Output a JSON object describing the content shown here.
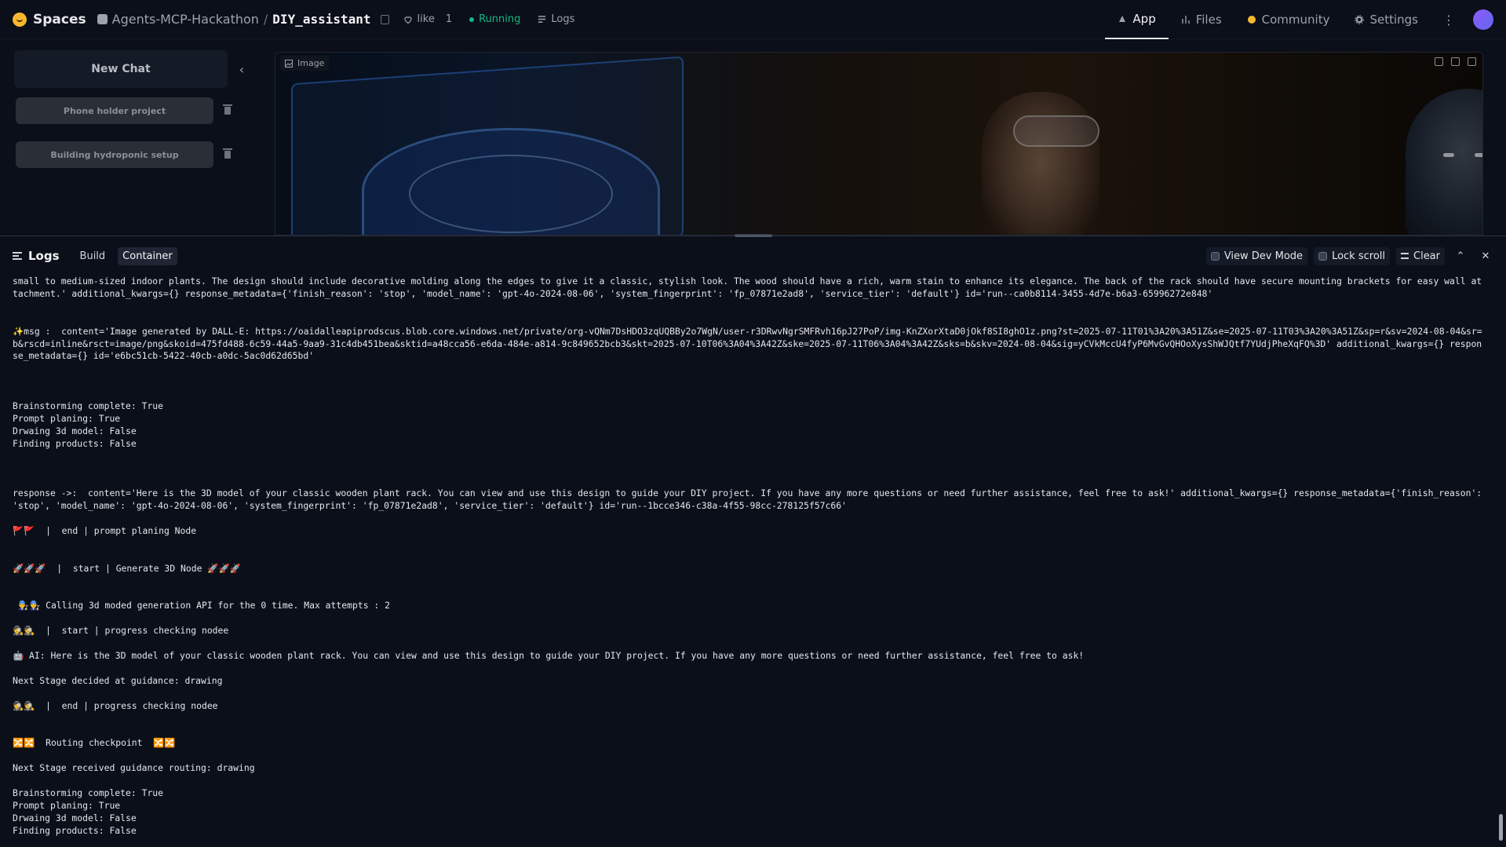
{
  "topbar": {
    "brand": "Spaces",
    "org": "Agents-MCP-Hackathon",
    "slash": "/",
    "repo": "DIY_assistant",
    "like_label": "like",
    "like_count": "1",
    "status": "Running",
    "logs_label": "Logs",
    "tabs": [
      {
        "label": "App",
        "active": true
      },
      {
        "label": "Files",
        "active": false
      },
      {
        "label": "Community",
        "active": false
      },
      {
        "label": "Settings",
        "active": false
      }
    ]
  },
  "sidebar": {
    "new_chat": "New Chat",
    "chats": [
      {
        "label": "Phone holder project"
      },
      {
        "label": "Building hydroponic setup"
      }
    ]
  },
  "image_panel": {
    "label": "Image"
  },
  "logs_panel": {
    "title": "Logs",
    "tabs": [
      {
        "label": "Build",
        "active": false
      },
      {
        "label": "Container",
        "active": true
      }
    ],
    "view_dev_mode": "View Dev Mode",
    "lock_scroll": "Lock scroll",
    "clear": "Clear",
    "lines": [
      "small to medium-sized indoor plants. The design should include decorative molding along the edges to give it a classic, stylish look. The wood should have a rich, warm stain to enhance its elegance. The back of the rack should have secure mounting brackets for easy wall attachment.' additional_kwargs={} response_metadata={'finish_reason': 'stop', 'model_name': 'gpt-4o-2024-08-06', 'system_fingerprint': 'fp_07871e2ad8', 'service_tier': 'default'} id='run--ca0b8114-3455-4d7e-b6a3-65996272e848'",
      "",
      "",
      "✨msg :  content='Image generated by DALL-E: https://oaidalleapiprodscus.blob.core.windows.net/private/org-vQNm7DsHDO3zqUQBBy2o7WgN/user-r3DRwvNgrSMFRvh16pJ27PoP/img-KnZXorXtaD0jOkf8SI8ghO1z.png?st=2025-07-11T01%3A20%3A51Z&se=2025-07-11T03%3A20%3A51Z&sp=r&sv=2024-08-04&sr=b&rscd=inline&rsct=image/png&skoid=475fd488-6c59-44a5-9aa9-31c4db451bea&sktid=a48cca56-e6da-484e-a814-9c849652bcb3&skt=2025-07-10T06%3A04%3A42Z&ske=2025-07-11T06%3A04%3A42Z&sks=b&skv=2024-08-04&sig=yCVkMccU4fyP6MvGvQHOoXysShWJQtf7YUdjPheXqFQ%3D' additional_kwargs={} response_metadata={} id='e6bc51cb-5422-40cb-a0dc-5ac0d62d65bd'",
      "",
      "",
      "",
      "Brainstorming complete: True",
      "Prompt planing: True",
      "Drwaing 3d model: False",
      "Finding products: False",
      "",
      "",
      "",
      "response ->:  content='Here is the 3D model of your classic wooden plant rack. You can view and use this design to guide your DIY project. If you have any more questions or need further assistance, feel free to ask!' additional_kwargs={} response_metadata={'finish_reason': 'stop', 'model_name': 'gpt-4o-2024-08-06', 'system_fingerprint': 'fp_07871e2ad8', 'service_tier': 'default'} id='run--1bcce346-c38a-4f55-98cc-278125f57c66'",
      "",
      "🚩🚩  |  end | prompt planing Node",
      "",
      "",
      "🚀🚀🚀  |  start | Generate 3D Node 🚀🚀🚀",
      "",
      "",
      " 👨‍🔧👨‍🔧 Calling 3d moded generation API for the 0 time. Max attempts : 2",
      "",
      "🕵️🕵️  |  start | progress checking nodee",
      "",
      "🤖 AI: Here is the 3D model of your classic wooden plant rack. You can view and use this design to guide your DIY project. If you have any more questions or need further assistance, feel free to ask!",
      "",
      "Next Stage decided at guidance: drawing",
      "",
      "🕵️🕵️  |  end | progress checking nodee",
      "",
      "",
      "🔀🔀  Routing checkpoint  🔀🔀",
      "",
      "Next Stage received guidance routing: drawing",
      "",
      "Brainstorming complete: True",
      "Prompt planing: True",
      "Drwaing 3d model: False",
      "Finding products: False"
    ]
  }
}
